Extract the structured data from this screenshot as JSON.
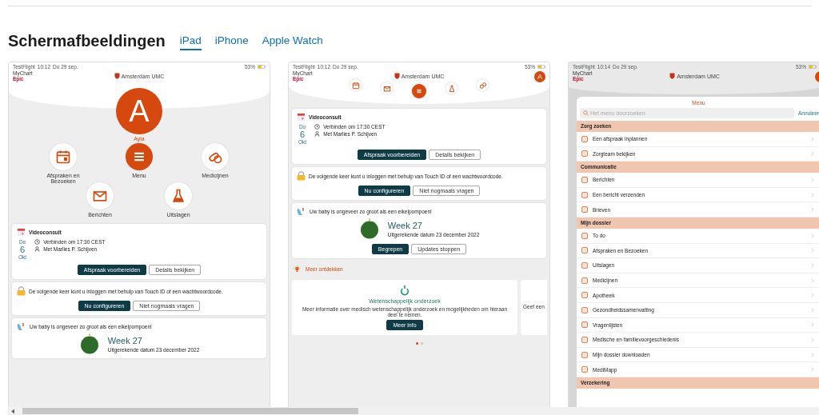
{
  "heading": "Schermafbeeldingen",
  "tabs": [
    {
      "label": "iPad",
      "selected": true
    },
    {
      "label": "iPhone",
      "selected": false
    },
    {
      "label": "Apple Watch",
      "selected": false
    }
  ],
  "screenshots": [
    {
      "kind": "home",
      "status": {
        "carrier": "TestFlight",
        "time": "10:12",
        "date": "Do 29 sep.",
        "battery": "53%"
      },
      "brand": "MyChart",
      "brand_by": "Epic",
      "hospital": "Amsterdam UMC",
      "avatar": "A",
      "user": "Ayla",
      "launcher": [
        {
          "label": "Afspraken en Bezoeken",
          "selected": false
        },
        {
          "label": "Menu",
          "selected": true
        },
        {
          "label": "Medicijnen",
          "selected": false
        },
        {
          "label": "Berichten",
          "selected": false
        },
        {
          "label": "Uitslagen",
          "selected": false
        }
      ],
      "appointment": {
        "title": "Videoconsult",
        "weekday": "Do",
        "day": "6",
        "month": "Okt",
        "lines": [
          "Verbinden om 17:30 CEST",
          "Met Marlies P. Schijven"
        ],
        "buttons": [
          {
            "label": "Afspraak voorbereiden",
            "primary": true
          },
          {
            "label": "Details bekijken",
            "primary": false
          }
        ]
      },
      "touch_id": {
        "text": "De volgende keer kunt u inloggen met behulp van Touch ID of een wachtwoordcode.",
        "buttons": [
          {
            "label": "Nu configureren",
            "primary": true
          },
          {
            "label": "Niet nogmaals vragen",
            "primary": false
          }
        ]
      },
      "baby": {
        "text": "Uw baby is ongeveer zo groot als een eikelpompoen!",
        "week": "Week 27",
        "due": "Uitgerekende datum 23 december 2022"
      }
    },
    {
      "kind": "dashboard",
      "status": {
        "carrier": "TestFlight",
        "time": "10:12",
        "date": "Do 29 sep.",
        "battery": "53%"
      },
      "brand": "MyChart",
      "brand_by": "Epic",
      "hospital": "Amsterdam UMC",
      "avatar": "A",
      "shortcuts": [
        {
          "selected": false
        },
        {
          "selected": false
        },
        {
          "selected": true
        },
        {
          "selected": false
        },
        {
          "selected": false
        }
      ],
      "appointment": {
        "title": "Videoconsult",
        "weekday": "Do",
        "day": "6",
        "month": "Okt",
        "lines": [
          "Verbinden om 17:30 CEST",
          "Met Marlies P. Schijven"
        ],
        "buttons": [
          {
            "label": "Afspraak voorbereiden",
            "primary": true
          },
          {
            "label": "Details bekijken",
            "primary": false
          }
        ]
      },
      "touch_id": {
        "text": "De volgende keer kunt u inloggen met behulp van Touch ID of een wachtwoordcode.",
        "buttons": [
          {
            "label": "Nu configureren",
            "primary": true
          },
          {
            "label": "Niet nogmaals vragen",
            "primary": false
          }
        ]
      },
      "baby": {
        "text": "Uw baby is ongeveer zo groot als een eikelpompoen!",
        "week": "Week 27",
        "due": "Uitgerekende datum 23 december 2022",
        "buttons": [
          {
            "label": "Begrepen",
            "primary": true
          },
          {
            "label": "Updates stoppen",
            "primary": false
          }
        ]
      },
      "discover": {
        "title": "Meer ontdekken",
        "cards": [
          {
            "title": "Wetenschappelijk onderzoek",
            "text": "Meer informatie over medisch wetenschappelijk onderzoek en mogelijkheden om hieraan deel te nemen.",
            "button": "Meer info"
          },
          {
            "text": "Geef een"
          }
        ],
        "pages": [
          {
            "selected": true
          },
          {
            "selected": false
          }
        ]
      }
    },
    {
      "kind": "menu",
      "status": {
        "carrier": "TestFlight",
        "time": "10:14",
        "date": "Do 29 sep.",
        "battery": "53%"
      },
      "brand": "MyChart",
      "brand_by": "Epic",
      "hospital": "Amsterdam UMC",
      "menu": {
        "title": "Menu",
        "placeholder": "Het menu doorzoeken",
        "cancel": "Annuleer",
        "sections": [
          {
            "title": "Zorg zoeken",
            "items": [
              "Een afspraak inplannen",
              "Zorgteam bekijken"
            ]
          },
          {
            "title": "Communicatie",
            "items": [
              "Berichten",
              "Een bericht verzenden",
              "Brieven"
            ]
          },
          {
            "title": "Mijn dossier",
            "items": [
              "To do",
              "Afspraken en Bezoeken",
              "Uitslagen",
              "Medicijnen",
              "Apotheek",
              "Gezondheidssamenvatting",
              "Vragenlijsten",
              "Medische en familievoorgeschiedenis",
              "Mijn dossier downloaden",
              "MediMapp"
            ]
          },
          {
            "title": "Verzekering"
          }
        ]
      }
    }
  ]
}
